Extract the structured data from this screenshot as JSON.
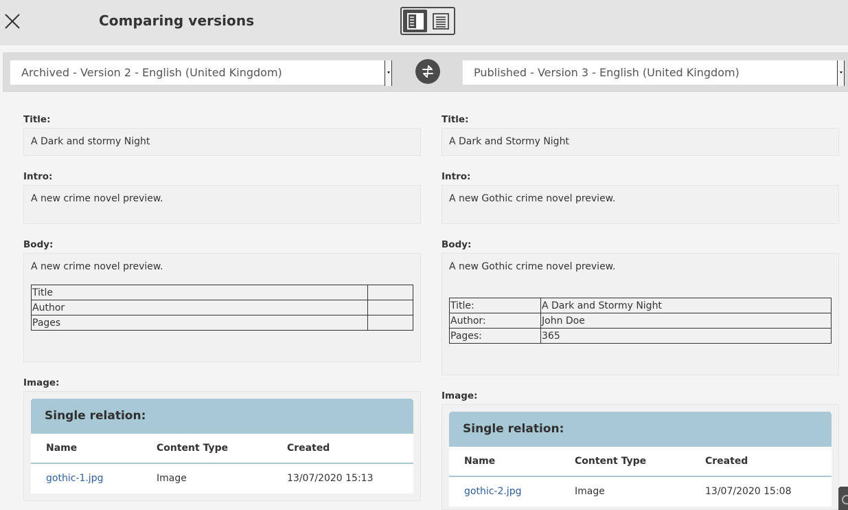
{
  "header": {
    "title": "Comparing versions",
    "close_icon": "close-icon",
    "view_modes": [
      "side-by-side-view-icon",
      "single-column-view-icon"
    ],
    "active_view": "side-by-side"
  },
  "selectors": {
    "left": "Archived - Version 2 - English (United Kingdom)",
    "right": "Published - Version 3 - English (United Kingdom)",
    "swap_icon": "swap-arrows-icon"
  },
  "labels": {
    "title": "Title:",
    "intro": "Intro:",
    "body": "Body:",
    "image": "Image:"
  },
  "left": {
    "title": "A Dark and stormy Night",
    "intro": "A new crime novel preview.",
    "body_text": "A new crime novel preview.",
    "body_table": [
      [
        "Title",
        ""
      ],
      [
        "Author",
        ""
      ],
      [
        "Pages",
        ""
      ]
    ],
    "relation": {
      "heading": "Single relation:",
      "columns": [
        "Name",
        "Content Type",
        "Created"
      ],
      "row": {
        "name": "gothic-1.jpg",
        "type": "Image",
        "created": "13/07/2020 15:13"
      }
    }
  },
  "right": {
    "title": "A Dark and Stormy Night",
    "intro": "A new Gothic crime novel preview.",
    "body_text": "A new Gothic crime novel preview.",
    "body_table": [
      [
        "Title:",
        "A Dark and Stormy Night"
      ],
      [
        "Author:",
        "John Doe"
      ],
      [
        "Pages:",
        "365"
      ]
    ],
    "relation": {
      "heading": "Single relation:",
      "columns": [
        "Name",
        "Content Type",
        "Created"
      ],
      "row": {
        "name": "gothic-2.jpg",
        "type": "Image",
        "created": "13/07/2020 15:08"
      }
    }
  },
  "colors": {
    "topbar": "#e5e4e4",
    "relation_header": "#a8c8d5",
    "link": "#2b5f9e",
    "dark_button": "#4b4b4b"
  }
}
